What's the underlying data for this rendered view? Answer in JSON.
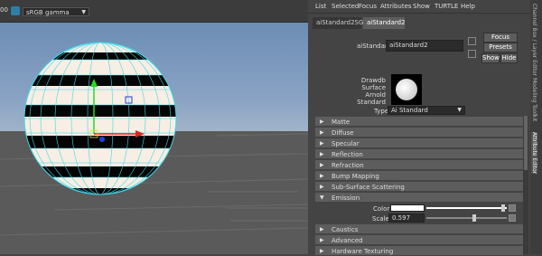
{
  "viewport": {
    "left_number": "00",
    "color_management_icon": "color-management-icon",
    "gamma_label": "sRGB gamma"
  },
  "menubar": [
    "List",
    "Selected",
    "Focus",
    "Attributes",
    "Show",
    "TURTLE",
    "Help"
  ],
  "tabs": [
    {
      "label": "aiStandard2SG",
      "active": false
    },
    {
      "label": "aiStandard2",
      "active": true
    }
  ],
  "node": {
    "label": "aiStandard:",
    "value": "aiStandard2"
  },
  "buttons": {
    "focus": "Focus",
    "presets": "Presets",
    "show": "Show",
    "hide": "Hide"
  },
  "swatch": {
    "label_lines": [
      "Drawdb",
      "Surface",
      "Arnold",
      "Standard"
    ]
  },
  "type": {
    "label": "Type",
    "value": "Ai Standard"
  },
  "sections_top": [
    {
      "label": "Matte"
    },
    {
      "label": "Diffuse"
    },
    {
      "label": "Specular"
    },
    {
      "label": "Reflection"
    },
    {
      "label": "Refraction"
    },
    {
      "label": "Bump Mapping"
    },
    {
      "label": "Sub-Surface Scattering"
    },
    {
      "label": "Emission"
    }
  ],
  "emission": {
    "color_label": "Color",
    "scale_label": "Scale",
    "scale_value": "0.597",
    "scale_fraction": 0.597,
    "color_hex": "#ffffff"
  },
  "sections_bottom": [
    {
      "label": "Caustics"
    },
    {
      "label": "Advanced"
    },
    {
      "label": "Hardware Texturing"
    }
  ],
  "side_tabs": [
    {
      "label": "Channel Box / Layer Editor",
      "active": false
    },
    {
      "label": "Modeling Toolkit",
      "active": false
    },
    {
      "label": "Attribute Editor",
      "active": true
    }
  ],
  "colors": {
    "panel_bg": "#444444",
    "section_bg": "#5d5d5d",
    "sky_top": "#6c8db4",
    "axis_x": "#e02020",
    "axis_y": "#20e020",
    "axis_z": "#2040e0",
    "wire": "#3fd8e8"
  }
}
